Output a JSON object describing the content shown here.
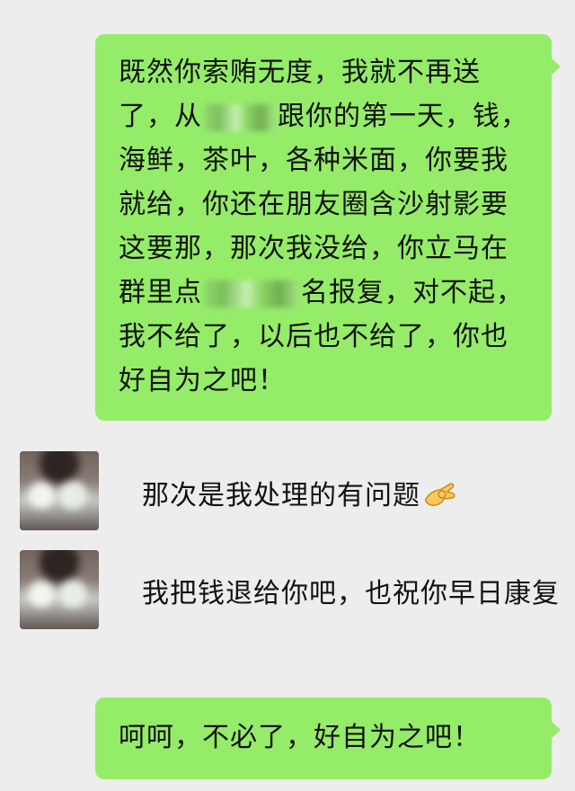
{
  "messages": {
    "out1": {
      "part1": "既然你索贿无度，我就不再送了，从",
      "part2": "跟你的第一天，钱，海鲜，茶叶，各种米面，你要我就给，你还在朋友圈含沙射影要这要那，那次我没给，你立马在群里点",
      "part3": "名报复，对不起，我不给了，以后也不给了，你也好自为之吧！"
    },
    "in1": {
      "text": "那次是我处理的有问题",
      "emoji": "ok-hand-emoji"
    },
    "in2": {
      "text": "我把钱退给你吧，也祝你早日康复"
    },
    "out2": {
      "text": "呵呵，不必了，好自为之吧！"
    }
  },
  "colors": {
    "background": "#ededed",
    "outgoing_bubble": "#95ec69",
    "text": "#111111"
  }
}
